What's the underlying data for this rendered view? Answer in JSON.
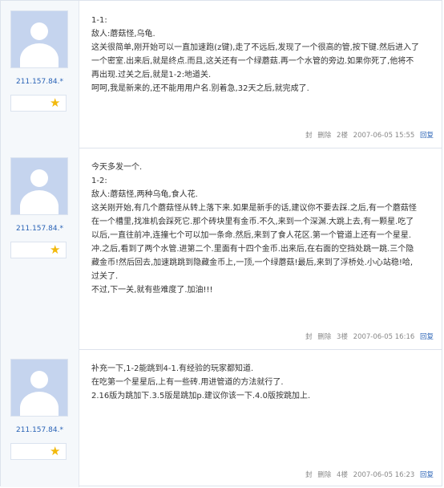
{
  "actions": {
    "seal": "封",
    "delete": "删除",
    "reply": "回复"
  },
  "posts": [
    {
      "ip": "211.157.84.*",
      "lines": [
        "1-1:",
        "敌人:蘑菇怪,乌龟.",
        "这关很简单,刚开始可以一直加速跑(z键),走了不远后,发现了一个很高的管,按下键.然后进入了",
        "一个密室.出来后,就是终点.而且,这关还有一个绿蘑菇.再一个水管的旁边.如果你死了,他将不",
        "再出现.过关之后,就是1-2:地道关.",
        " 呵呵,我是新来的,还不能用用户名.别着急,32天之后,就完成了."
      ],
      "floor": "2楼",
      "timestamp": "2007-06-05 15:55"
    },
    {
      "ip": "211.157.84.*",
      "lines": [
        "今天多发一个.",
        "1-2:",
        "敌人:蘑菇怪,两种乌龟,食人花.",
        "这关刚开始,有几个蘑菇怪从转上落下来.如果是新手的话,建议你不要去踩.之后,有一个蘑菇怪",
        "在一个槽里,找准机会踩死它.那个砖块里有金币.不久,来到一个深渊.大跳上去,有一颗星.吃了",
        "以后,一直往前冲,连撞七个可以加一条命.然后,来到了食人花区.第一个管道上还有一个星星.",
        "冲.之后,看到了两个水管.进第二个.里面有十四个金币.出来后,在右面的空挡处跳一跳.三个隐",
        "藏金币!然后回去,加速跳跳到隐藏金币上,一顶,一个绿蘑菇!最后,来到了浮桥处.小心站稳!哈,",
        "过关了.",
        "不过,下一关,就有些难度了.加油!!!"
      ],
      "floor": "3楼",
      "timestamp": "2007-06-05 16:16"
    },
    {
      "ip": "211.157.84.*",
      "lines": [
        "补充一下,1-2能跳到4-1.有经验的玩家都知道.",
        "在吃第一个星星后,上有一些砖.用进管道的方法就行了.",
        "2.16版为跳加下.3.5版是跳加p.建议你该一下.4.0版按跳加上."
      ],
      "floor": "4楼",
      "timestamp": "2007-06-05 16:23"
    }
  ]
}
